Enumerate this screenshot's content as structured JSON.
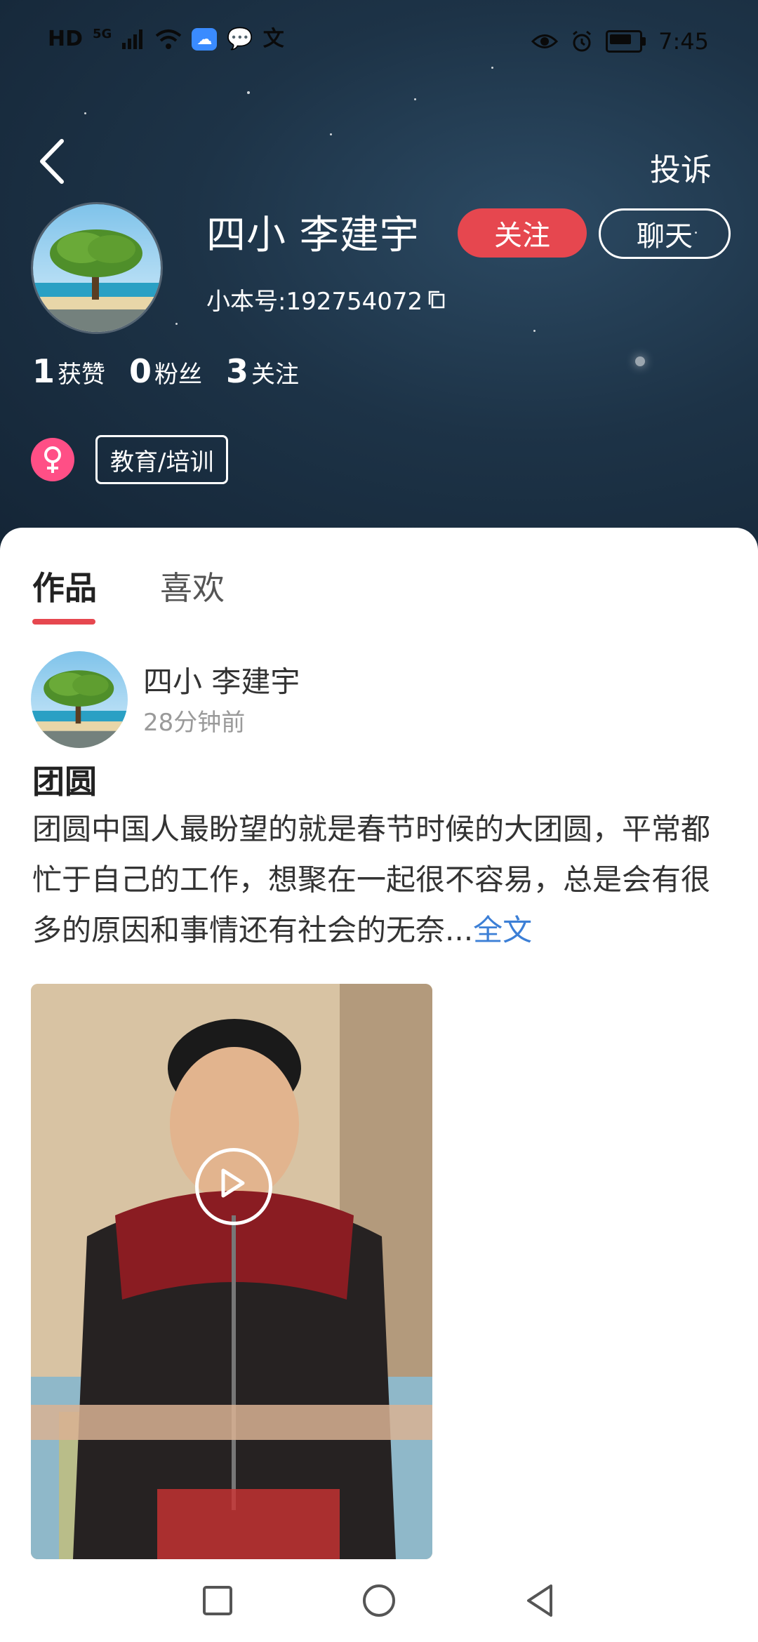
{
  "status_bar": {
    "left_icons": [
      "HD",
      "5G",
      "signal-icon",
      "wifi-icon",
      "cloud-icon",
      "message-icon",
      "translate-icon"
    ],
    "hd_text": "HD",
    "net_text": "5G",
    "right_icons": [
      "eye-icon",
      "alarm-icon",
      "battery-icon"
    ],
    "time": "7:45"
  },
  "header": {
    "report_label": "投诉",
    "username": "四小 李建宇",
    "follow_label": "关注",
    "chat_label": "聊天",
    "account_id": "小本号:192754072",
    "stats": [
      {
        "num": "1",
        "label": "获赞"
      },
      {
        "num": "0",
        "label": "粉丝"
      },
      {
        "num": "3",
        "label": "关注"
      }
    ],
    "gender_icon": "female-icon",
    "tag": "教育/培训"
  },
  "tabs": [
    {
      "label": "作品",
      "active": true
    },
    {
      "label": "喜欢",
      "active": false
    }
  ],
  "post": {
    "author": "四小 李建宇",
    "time": "28分钟前",
    "title": "团圆",
    "body": "团圆中国人最盼望的就是春节时候的大团圆，平常都忙于自己的工作，想聚在一起很不容易，总是会有很多的原因和事情还有社会的无奈...",
    "full_link": "全文"
  },
  "nav_bar": {
    "buttons": [
      "recent-apps",
      "home",
      "back"
    ]
  },
  "colors": {
    "accent": "#e6474f",
    "link": "#3c7fd6",
    "gender": "#ff4f86"
  }
}
